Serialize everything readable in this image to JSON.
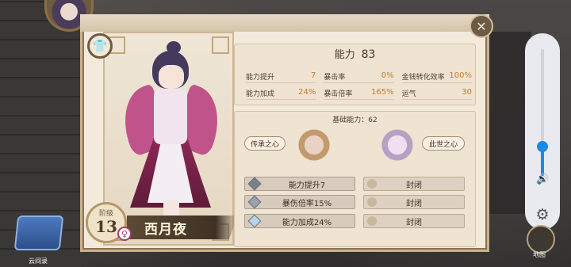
{
  "character": {
    "rank_label": "阶级",
    "rank_value": "13",
    "gender_symbol": "♀",
    "name": "西月夜"
  },
  "stats": {
    "title": "能力",
    "title_value": "83",
    "items": [
      {
        "label": "能力提升",
        "value": "7"
      },
      {
        "label": "暴击率",
        "value": "0%"
      },
      {
        "label": "金钱转化效率",
        "value": "100%"
      },
      {
        "label": "能力加成",
        "value": "24%"
      },
      {
        "label": "暴击倍率",
        "value": "165%"
      },
      {
        "label": "运气",
        "value": "30"
      }
    ]
  },
  "abilities": {
    "title": "基础能力：62",
    "left_heart_label": "传承之心",
    "right_heart_label": "此世之心",
    "left_slots": [
      {
        "label": "能力提升7",
        "gem_color": "#7a7f8a"
      },
      {
        "label": "暴伤倍率15%",
        "gem_color": "#9aa3ad"
      },
      {
        "label": "能力加成24%",
        "gem_color": "#b8d3ea"
      }
    ],
    "right_slots": [
      {
        "label": "封闭"
      },
      {
        "label": "封闭"
      },
      {
        "label": "封闭"
      }
    ]
  },
  "bottom_left": {
    "label": "云间录"
  },
  "sidebar": {
    "volume_level": 0.23,
    "map_label": "地图"
  },
  "icons": {
    "close": "close-icon",
    "shirt": "shirt-icon",
    "speaker": "speaker-icon",
    "gear": "gear-icon"
  }
}
